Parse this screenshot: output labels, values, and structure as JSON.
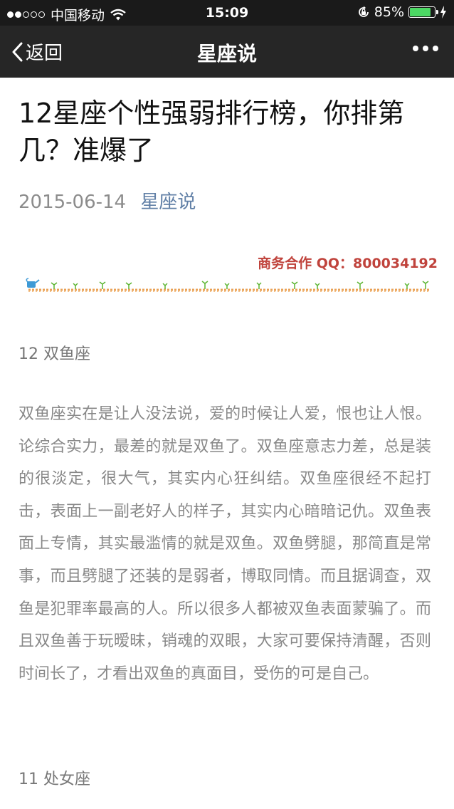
{
  "status_bar": {
    "carrier": "中国移动",
    "time": "15:09",
    "battery_percent": "85%",
    "battery_level": 0.85,
    "signal_bars_filled": 2,
    "signal_bars_total": 5
  },
  "nav": {
    "back_label": "返回",
    "title": "星座说"
  },
  "article": {
    "title": "12星座个性强弱排行榜，你排第几？准爆了",
    "date": "2015-06-14",
    "account": "星座说",
    "banner_text": "商务合作 QQ：800034192",
    "sections": [
      {
        "heading": "12 双鱼座",
        "body": "双鱼座实在是让人没法说，爱的时候让人爱，恨也让人恨。论综合实力，最差的就是双鱼了。双鱼座意志力差，总是装的很淡定，很大气，其实内心狂纠结。双鱼座很经不起打击，表面上一副老好人的样子，其实内心暗暗记仇。双鱼表面上专情，其实最滥情的就是双鱼。双鱼劈腿，那简直是常事，而且劈腿了还装的是弱者，博取同情。而且据调查，双鱼是犯罪率最高的人。所以很多人都被双鱼表面蒙骗了。而且双鱼善于玩暧昧，销魂的双眼，大家可要保持清醒，否则时间长了，才看出双鱼的真面目，受伤的可是自己。"
      },
      {
        "heading": "11 处女座"
      }
    ]
  },
  "colors": {
    "nav_background": "#262626",
    "status_background": "#1a1a1a",
    "link": "#607fa6",
    "banner_red": "#c0433c",
    "battery_green": "#4cd964",
    "body_text": "#888888"
  },
  "icons": [
    "wifi-icon",
    "back-chevron-icon",
    "more-icon",
    "orientation-lock-icon",
    "charging-bolt-icon",
    "watering-can-icon",
    "sprout-icon"
  ]
}
